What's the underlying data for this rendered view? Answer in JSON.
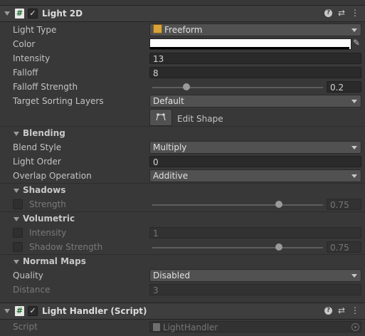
{
  "light2d": {
    "title": "Light 2D",
    "enabled": true,
    "light_type": {
      "label": "Light Type",
      "value": "Freeform"
    },
    "color": {
      "label": "Color",
      "value": "#ffffff"
    },
    "intensity": {
      "label": "Intensity",
      "value": "13"
    },
    "falloff": {
      "label": "Falloff",
      "value": "8"
    },
    "falloff_strength": {
      "label": "Falloff Strength",
      "value": "0.2",
      "fraction": 0.2
    },
    "target_sorting_layers": {
      "label": "Target Sorting Layers",
      "value": "Default"
    },
    "edit_shape_label": "Edit Shape"
  },
  "blending": {
    "title": "Blending",
    "blend_style": {
      "label": "Blend Style",
      "value": "Multiply"
    },
    "light_order": {
      "label": "Light Order",
      "value": "0"
    },
    "overlap_operation": {
      "label": "Overlap Operation",
      "value": "Additive"
    }
  },
  "shadows": {
    "title": "Shadows",
    "strength": {
      "label": "Strength",
      "value": "0.75",
      "fraction": 0.75
    }
  },
  "volumetric": {
    "title": "Volumetric",
    "intensity": {
      "label": "Intensity",
      "value": "1"
    },
    "shadow_strength": {
      "label": "Shadow Strength",
      "value": "0.75",
      "fraction": 0.75
    }
  },
  "normal_maps": {
    "title": "Normal Maps",
    "quality": {
      "label": "Quality",
      "value": "Disabled"
    },
    "distance": {
      "label": "Distance",
      "value": "3"
    }
  },
  "light_handler": {
    "title": "Light Handler (Script)",
    "enabled": true,
    "script": {
      "label": "Script",
      "value": "LightHandler"
    }
  },
  "icons": {
    "component_icon": "script-hash-icon",
    "help_icon": "help-icon",
    "presets_icon": "sliders-icon",
    "menu_icon": "kebab-menu-icon",
    "eyedropper_icon": "eyedropper-icon",
    "edit_shape_icon": "edit-shape-icon"
  },
  "colors": {
    "background": "#383838",
    "header": "#3e3e3e",
    "field": "#2a2a2a"
  }
}
